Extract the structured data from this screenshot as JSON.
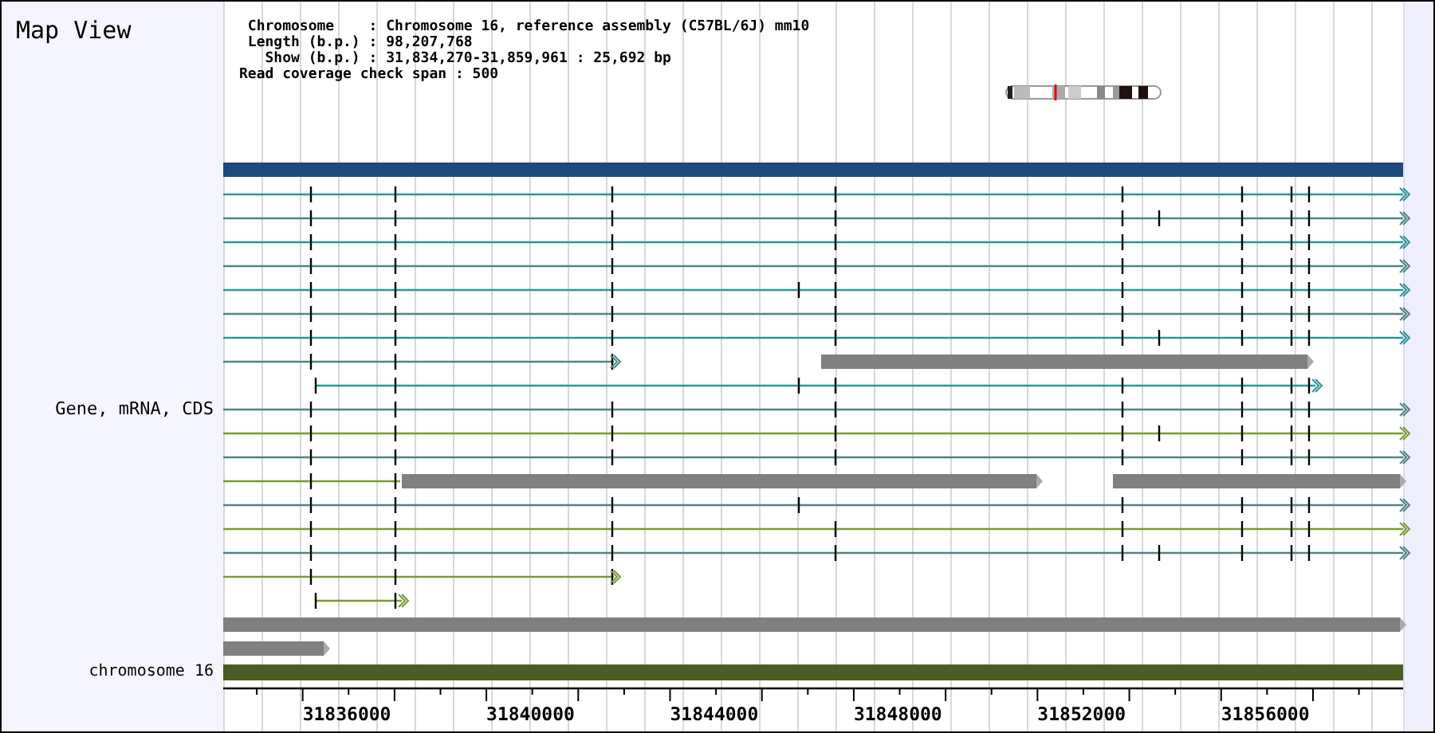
{
  "title": "Map View",
  "info_lines": [
    "Chromosome    : Chromosome 16, reference assembly (C57BL/6J) mm10",
    "Length (b.p.) : 98,207,768",
    "Show (b.p.) : 31,834,270-31,859,961 : 25,692 bp",
    "Read coverage check span : 500"
  ],
  "tracks": [
    {
      "label": "Gene, mRNA, CDS"
    },
    {
      "label": "chromosome 16"
    }
  ],
  "axis": {
    "labels": [
      "31836000",
      "31840000",
      "31844000",
      "31848000",
      "31852000",
      "31856000"
    ]
  }
}
